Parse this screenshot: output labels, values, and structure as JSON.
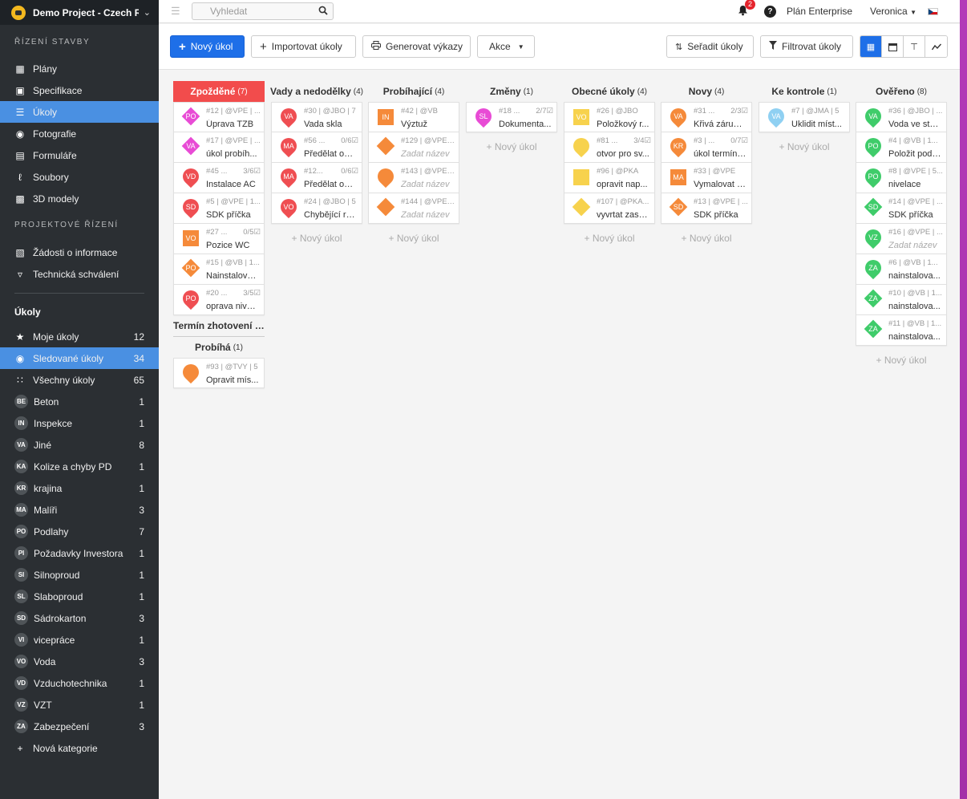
{
  "project": {
    "title": "Demo Project - Czech Republic"
  },
  "header": {
    "search_placeholder": "Vyhledat",
    "notifications": "2",
    "help": "?",
    "plan": "Plán Enterprise",
    "user": "Veronica"
  },
  "sidebar": {
    "section_build": "ŘÍZENÍ STAVBY",
    "build_items": [
      {
        "label": "Plány",
        "icon": "map-icon"
      },
      {
        "label": "Specifikace",
        "icon": "cube-icon"
      },
      {
        "label": "Úkoly",
        "icon": "list-icon"
      },
      {
        "label": "Fotografie",
        "icon": "camera-icon"
      },
      {
        "label": "Formuláře",
        "icon": "form-icon"
      },
      {
        "label": "Soubory",
        "icon": "paperclip-icon"
      },
      {
        "label": "3D modely",
        "icon": "3d-cube-icon"
      }
    ],
    "section_project": "PROJEKTOVÉ ŘÍZENÍ",
    "project_items": [
      {
        "label": "Žádosti o informace",
        "icon": "document-info-icon"
      },
      {
        "label": "Technická schválení",
        "icon": "stamp-icon"
      }
    ],
    "tasks_header": "Úkoly",
    "task_filters": [
      {
        "label": "Moje úkoly",
        "count": "12",
        "icon": "star-icon"
      },
      {
        "label": "Sledované úkoly",
        "count": "34",
        "icon": "eye-icon"
      },
      {
        "label": "Všechny úkoly",
        "count": "65",
        "icon": "grid-icon"
      }
    ],
    "categories": [
      {
        "abbr": "BE",
        "label": "Beton",
        "count": "1"
      },
      {
        "abbr": "IN",
        "label": "Inspekce",
        "count": "1"
      },
      {
        "abbr": "VA",
        "label": "Jiné",
        "count": "8"
      },
      {
        "abbr": "KA",
        "label": "Kolize a chyby PD",
        "count": "1"
      },
      {
        "abbr": "KR",
        "label": "krajina",
        "count": "1"
      },
      {
        "abbr": "MA",
        "label": "Malíři",
        "count": "3"
      },
      {
        "abbr": "PO",
        "label": "Podlahy",
        "count": "7"
      },
      {
        "abbr": "PI",
        "label": "Požadavky Investora",
        "count": "1"
      },
      {
        "abbr": "SI",
        "label": "Silnoproud",
        "count": "1"
      },
      {
        "abbr": "SL",
        "label": "Slaboproud",
        "count": "1"
      },
      {
        "abbr": "SD",
        "label": "Sádrokarton",
        "count": "3"
      },
      {
        "abbr": "VI",
        "label": "vicepráce",
        "count": "1"
      },
      {
        "abbr": "VO",
        "label": "Voda",
        "count": "3"
      },
      {
        "abbr": "VD",
        "label": "Vzduchotechnika",
        "count": "1"
      },
      {
        "abbr": "VZ",
        "label": "VZT",
        "count": "1"
      },
      {
        "abbr": "ZA",
        "label": "Zabezpečení",
        "count": "3"
      }
    ],
    "new_category": "Nová kategorie"
  },
  "toolbar": {
    "new_task": "Nový úkol",
    "import": "Importovat úkoly",
    "report": "Generovat výkazy",
    "actions": "Akce",
    "sort": "Seřadit úkoly",
    "filter": "Filtrovat úkoly"
  },
  "add_task_label": "+ Nový úkol",
  "colors": {
    "accent": "#1e6fe8",
    "overdue": "#f24c4c",
    "red": "#ef4e52",
    "orange": "#f58a3a",
    "yellow": "#f7d24d",
    "green": "#3fcc6a",
    "pink": "#e84bd5",
    "lightblue": "#8fd0f2"
  },
  "columns": [
    {
      "title": "Zpožděné",
      "count": "(7)",
      "cards": [
        {
          "meta": "#12 | @VPE | ...",
          "extra": "",
          "title": "Úprava TZB",
          "abbr": "PO",
          "shape": "diamond",
          "color": "#e84bd5"
        },
        {
          "meta": "#17 | @VPE | ...",
          "extra": "",
          "title": "úkol probíh...",
          "abbr": "VA",
          "shape": "diamond",
          "color": "#e84bd5"
        },
        {
          "meta": "#45 ...",
          "extra": "3/6☑",
          "title": "Instalace AC",
          "abbr": "VD",
          "shape": "pin",
          "color": "#ef4e52"
        },
        {
          "meta": "#5 | @VPE | 1...",
          "extra": "",
          "title": "SDK příčka",
          "abbr": "SD",
          "shape": "pin",
          "color": "#ef4e52"
        },
        {
          "meta": "#27 ...",
          "extra": "0/5☑",
          "title": "Pozice WC",
          "abbr": "VO",
          "shape": "square",
          "color": "#f58a3a"
        },
        {
          "meta": "#15 | @VB | 1...",
          "extra": "",
          "title": "Nainstalova...",
          "abbr": "PO",
          "shape": "diamond",
          "color": "#f58a3a"
        },
        {
          "meta": "#20 ...",
          "extra": "3/5☑",
          "title": "oprava nivel...",
          "abbr": "PO",
          "shape": "pin",
          "color": "#ef4e52"
        }
      ],
      "subgroup": "Termín zhotovení d...",
      "subcolumn": {
        "title": "Probíhá",
        "count": "(1)",
        "cards": [
          {
            "meta": "#93 | @TVY | 5",
            "extra": "",
            "title": "Opravit mís...",
            "abbr": "",
            "shape": "pin",
            "color": "#f58a3a"
          }
        ]
      }
    },
    {
      "title": "Vady a nedodělky",
      "count": "(4)",
      "cards": [
        {
          "meta": "#30 | @JBO | 7",
          "extra": "",
          "title": "Vada skla",
          "abbr": "VA",
          "shape": "pin",
          "color": "#ef4e52"
        },
        {
          "meta": "#56 ...",
          "extra": "0/6☑",
          "title": "Předělat om...",
          "abbr": "MA",
          "shape": "pin",
          "color": "#ef4e52"
        },
        {
          "meta": "#12...",
          "extra": "0/6☑",
          "title": "Předělat om...",
          "abbr": "MA",
          "shape": "pin",
          "color": "#ef4e52"
        },
        {
          "meta": "#24 | @JBO | 5",
          "extra": "",
          "title": "Chybějící ro...",
          "abbr": "VO",
          "shape": "pin",
          "color": "#ef4e52"
        }
      ]
    },
    {
      "title": "Probíhající",
      "count": "(4)",
      "cards": [
        {
          "meta": "#42 | @VB",
          "extra": "",
          "title": "Výztuž",
          "abbr": "IN",
          "shape": "square",
          "color": "#f58a3a"
        },
        {
          "meta": "#129 | @VPE ...",
          "extra": "",
          "title": "Zadat název",
          "placeholder": true,
          "abbr": "",
          "shape": "diamond",
          "color": "#f58a3a"
        },
        {
          "meta": "#143 | @VPE ...",
          "extra": "",
          "title": "Zadat název",
          "placeholder": true,
          "abbr": "",
          "shape": "pin",
          "color": "#f58a3a"
        },
        {
          "meta": "#144 | @VPE ...",
          "extra": "",
          "title": "Zadat název",
          "placeholder": true,
          "abbr": "",
          "shape": "diamond",
          "color": "#f58a3a"
        }
      ]
    },
    {
      "title": "Změny",
      "count": "(1)",
      "cards": [
        {
          "meta": "#18 ...",
          "extra": "2/7☑",
          "title": "Dokumenta...",
          "abbr": "SL",
          "shape": "pin",
          "color": "#e84bd5"
        }
      ]
    },
    {
      "title": "Obecné úkoly",
      "count": "(4)",
      "cards": [
        {
          "meta": "#26 | @JBO",
          "extra": "",
          "title": "Položkový r...",
          "abbr": "VO",
          "shape": "square",
          "color": "#f7d24d"
        },
        {
          "meta": "#81 ...",
          "extra": "3/4☑",
          "title": "otvor pro sv...",
          "abbr": "",
          "shape": "pin",
          "color": "#f7d24d"
        },
        {
          "meta": "#96 | @PKA",
          "extra": "",
          "title": "opravit nap...",
          "abbr": "",
          "shape": "square",
          "color": "#f7d24d"
        },
        {
          "meta": "#107 | @PKA...",
          "extra": "",
          "title": "vyvrtat zasu...",
          "abbr": "",
          "shape": "diamond",
          "color": "#f7d24d"
        }
      ]
    },
    {
      "title": "Novy",
      "count": "(4)",
      "cards": [
        {
          "meta": "#31 ...",
          "extra": "2/3☑",
          "title": "Křivá zárubeň",
          "abbr": "VA",
          "shape": "pin",
          "color": "#f58a3a"
        },
        {
          "meta": "#3 | ...",
          "extra": "0/7☑",
          "title": "úkol termín ...",
          "abbr": "KR",
          "shape": "pin",
          "color": "#f58a3a"
        },
        {
          "meta": "#33 | @VPE",
          "extra": "",
          "title": "Vymalovat s...",
          "abbr": "MA",
          "shape": "square",
          "color": "#f58a3a"
        },
        {
          "meta": "#13 | @VPE | ...",
          "extra": "",
          "title": "SDK příčka",
          "abbr": "SD",
          "shape": "diamond",
          "color": "#f58a3a"
        }
      ]
    },
    {
      "title": "Ke kontrole",
      "count": "(1)",
      "cards": [
        {
          "meta": "#7 | @JMA | 5",
          "extra": "",
          "title": "Uklidit míst...",
          "abbr": "VA",
          "shape": "pin",
          "color": "#8fd0f2"
        }
      ]
    },
    {
      "title": "Ověřeno",
      "count": "(8)",
      "cards": [
        {
          "meta": "#36 | @JBO | ...",
          "extra": "",
          "title": "Voda ve stře...",
          "abbr": "VA",
          "shape": "pin",
          "color": "#3fcc6a"
        },
        {
          "meta": "#4 | @VB | 1...",
          "extra": "",
          "title": "Položit podl...",
          "abbr": "PO",
          "shape": "pin",
          "color": "#3fcc6a"
        },
        {
          "meta": "#8 | @VPE | 5...",
          "extra": "",
          "title": "nivelace",
          "abbr": "PO",
          "shape": "pin",
          "color": "#3fcc6a"
        },
        {
          "meta": "#14 | @VPE | ...",
          "extra": "",
          "title": "SDK příčka",
          "abbr": "SD",
          "shape": "diamond",
          "color": "#3fcc6a"
        },
        {
          "meta": "#16 | @VPE | ...",
          "extra": "",
          "title": "Zadat název",
          "placeholder": true,
          "abbr": "VZ",
          "shape": "pin",
          "color": "#3fcc6a"
        },
        {
          "meta": "#6 | @VB | 1...",
          "extra": "",
          "title": "nainstalova...",
          "abbr": "ZA",
          "shape": "pin",
          "color": "#3fcc6a"
        },
        {
          "meta": "#10 | @VB | 1...",
          "extra": "",
          "title": "nainstalova...",
          "abbr": "ZA",
          "shape": "diamond",
          "color": "#3fcc6a"
        },
        {
          "meta": "#11 | @VB | 1...",
          "extra": "",
          "title": "nainstalova...",
          "abbr": "ZA",
          "shape": "diamond",
          "color": "#3fcc6a"
        }
      ]
    }
  ]
}
